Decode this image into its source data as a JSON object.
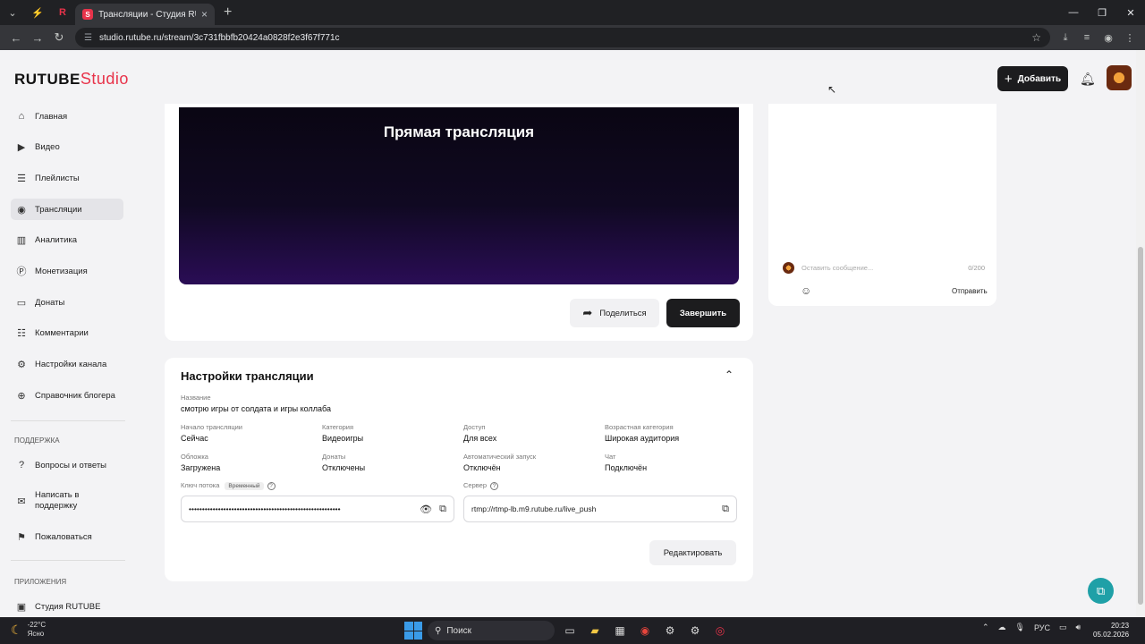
{
  "browser": {
    "tab_title": "Трансляции - Студия RUTUBE",
    "url": "studio.rutube.ru/stream/3c731fbbfb20424a0828f2e3f67f771c"
  },
  "header": {
    "logo_main": "RUTUBE",
    "logo_studio": "Studio",
    "add_label": "Добавить"
  },
  "sidebar": {
    "items": [
      {
        "label": "Главная",
        "icon": "home-icon"
      },
      {
        "label": "Видео",
        "icon": "video-icon"
      },
      {
        "label": "Плейлисты",
        "icon": "playlist-icon"
      },
      {
        "label": "Трансляции",
        "icon": "broadcast-icon",
        "active": true
      },
      {
        "label": "Аналитика",
        "icon": "chart-icon"
      },
      {
        "label": "Монетизация",
        "icon": "coin-icon"
      },
      {
        "label": "Донаты",
        "icon": "donate-icon"
      },
      {
        "label": "Комментарии",
        "icon": "comment-icon"
      },
      {
        "label": "Настройки канала",
        "icon": "gear-icon"
      },
      {
        "label": "Справочник блогера",
        "icon": "book-icon"
      }
    ],
    "support_heading": "ПОДДЕРЖКА",
    "support_items": [
      {
        "label": "Вопросы и ответы",
        "icon": "question-icon"
      },
      {
        "label": "Написать в поддержку",
        "icon": "mail-icon"
      },
      {
        "label": "Пожаловаться",
        "icon": "flag-icon"
      }
    ],
    "apps_heading": "ПРИЛОЖЕНИЯ",
    "apps_items": [
      {
        "label": "Студия RUTUBE",
        "icon": "app-icon"
      }
    ]
  },
  "player": {
    "title": "Прямая трансляция",
    "share_label": "Поделиться",
    "end_label": "Завершить"
  },
  "settings": {
    "title": "Настройки трансляции",
    "name_label": "Название",
    "name_value": "смотрю игры от солдата и игры коллаба",
    "fields": {
      "start_label": "Начало трансляции",
      "start_value": "Сейчас",
      "category_label": "Категория",
      "category_value": "Видеоигры",
      "access_label": "Доступ",
      "access_value": "Для всех",
      "age_label": "Возрастная категория",
      "age_value": "Широкая аудитория",
      "cover_label": "Обложка",
      "cover_value": "Загружена",
      "donate_label": "Донаты",
      "donate_value": "Отключены",
      "autostart_label": "Автоматический запуск",
      "autostart_value": "Отключён",
      "chat_label": "Чат",
      "chat_value": "Подключён"
    },
    "key_label": "Ключ потока",
    "key_badge": "Временный",
    "key_value": "•••••••••••••••••••••••••••••••••••••••••••••••••••••••••",
    "server_label": "Сервер",
    "server_value": "rtmp://rtmp-lb.m9.rutube.ru/live_push",
    "edit_label": "Редактировать"
  },
  "chat": {
    "placeholder": "Оставить сообщение...",
    "counter": "0/200",
    "send_label": "Отправить"
  },
  "taskbar": {
    "temperature": "-22°C",
    "weather": "Ясно",
    "search_label": "Поиск",
    "lang": "РУС",
    "time": "20:23",
    "date": "05.02.2026"
  },
  "colors": {
    "brand_red": "#e8334a",
    "dark_button": "#1c1c1e",
    "help_teal": "#1fa0a7"
  }
}
